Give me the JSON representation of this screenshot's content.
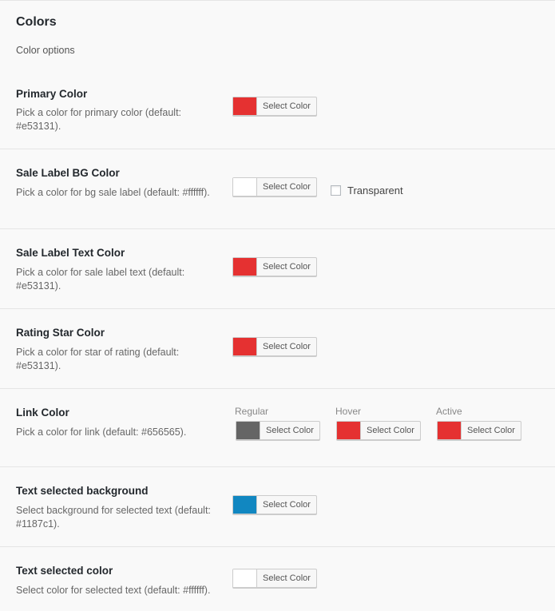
{
  "section": {
    "title": "Colors",
    "description": "Color options"
  },
  "select_color_label": "Select Color",
  "primary": {
    "title": "Primary Color",
    "description": "Pick a color for primary color (default: #e53131).",
    "value": "#e53131"
  },
  "sale_bg": {
    "title": "Sale Label BG Color",
    "description": "Pick a color for bg sale label (default: #ffffff).",
    "value": "#ffffff",
    "transparent_label": "Transparent",
    "transparent_checked": false
  },
  "sale_text": {
    "title": "Sale Label Text Color",
    "description": "Pick a color for sale label text (default: #e53131).",
    "value": "#e53131"
  },
  "rating": {
    "title": "Rating Star Color",
    "description": "Pick a color for star of rating (default: #e53131).",
    "value": "#e53131"
  },
  "link": {
    "title": "Link Color",
    "description": "Pick a color for link (default: #656565).",
    "regular_label": "Regular",
    "regular_value": "#656565",
    "hover_label": "Hover",
    "hover_value": "#e53131",
    "active_label": "Active",
    "active_value": "#e53131"
  },
  "sel_bg": {
    "title": "Text selected background",
    "description": "Select background for selected text (default: #1187c1).",
    "value": "#1187c1"
  },
  "sel_color": {
    "title": "Text selected color",
    "description": "Select color for selected text (default: #ffffff).",
    "value": "#ffffff"
  }
}
